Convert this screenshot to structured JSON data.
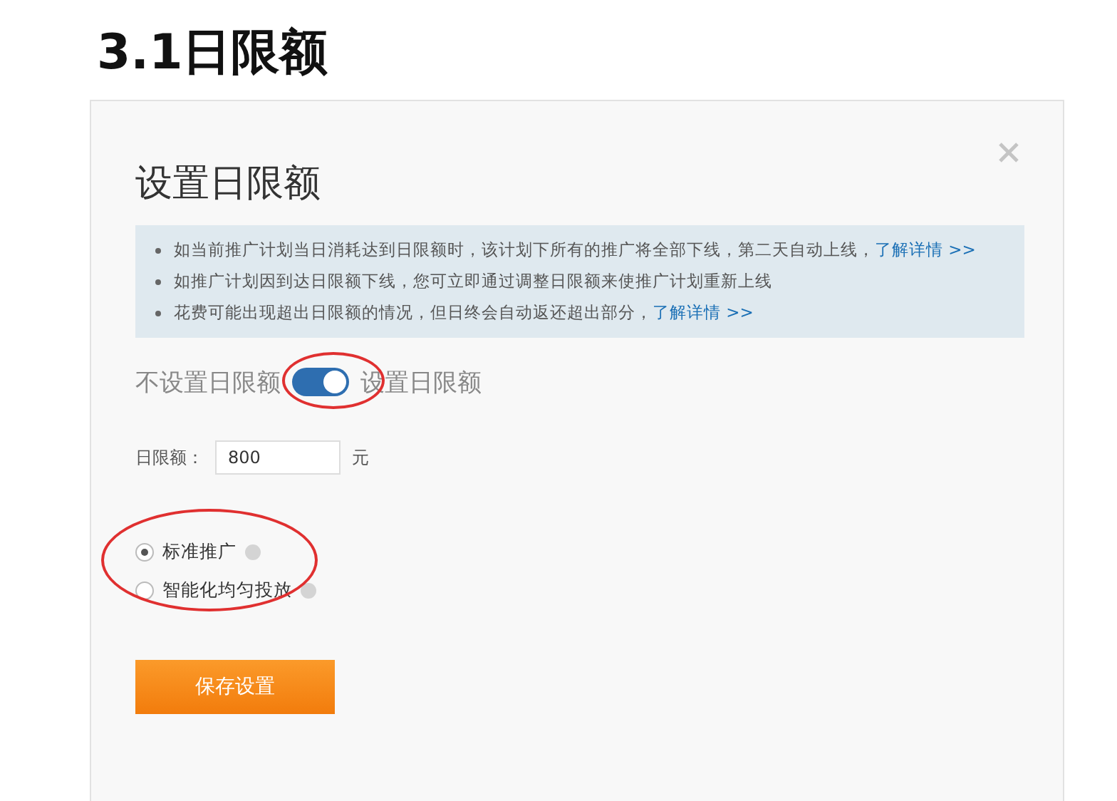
{
  "heading": "3.1日限额",
  "dialog": {
    "title": "设置日限额",
    "notes": [
      {
        "text": "如当前推广计划当日消耗达到日限额时，该计划下所有的推广将全部下线，第二天自动上线，",
        "link": "了解详情 >>"
      },
      {
        "text": "如推广计划因到达日限额下线，您可立即通过调整日限额来使推广计划重新上线"
      },
      {
        "text": "花费可能出现超出日限额的情况，但日终会自动返还超出部分，",
        "link": "了解详情 >>"
      }
    ],
    "toggle": {
      "off_label": "不设置日限额",
      "on_label": "设置日限额",
      "on": true
    },
    "limit": {
      "label": "日限额：",
      "value": "800",
      "unit": "元"
    },
    "modes": [
      {
        "label": "标准推广",
        "selected": true
      },
      {
        "label": "智能化均匀投放",
        "selected": false
      }
    ],
    "save_button": "保存设置"
  }
}
